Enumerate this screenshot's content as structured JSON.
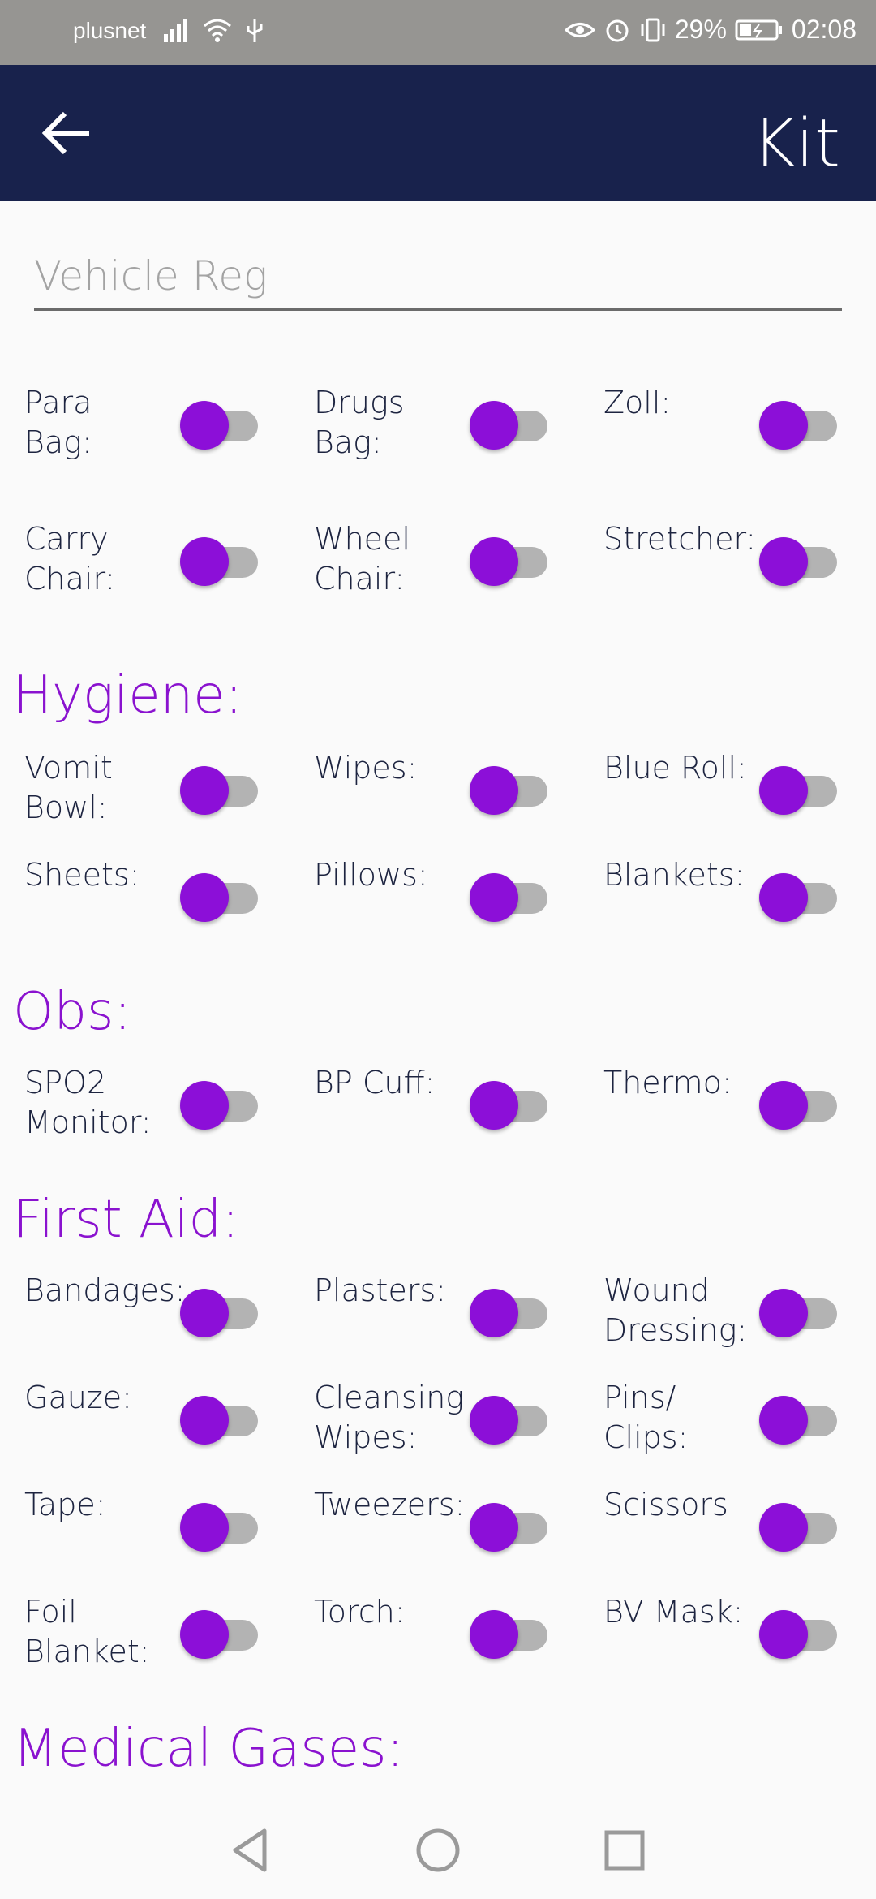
{
  "status_bar": {
    "carrier": "plusnet",
    "battery": "29%",
    "time": "02:08",
    "icons_left": [
      "signal-icon",
      "wifi-icon",
      "usb-icon"
    ],
    "icons_right": [
      "eye-icon",
      "alarm-icon",
      "vibrate-icon",
      "battery-icon"
    ]
  },
  "app_bar": {
    "title": "Kit",
    "back_icon": "arrow-left-icon"
  },
  "vehicle_reg": {
    "placeholder": "Vehicle Reg",
    "value": ""
  },
  "equipment": [
    {
      "label": "Para\nBag:",
      "on": false
    },
    {
      "label": "Drugs\nBag:",
      "on": false
    },
    {
      "label": "Zoll:",
      "on": false
    },
    {
      "label": "Carry\nChair:",
      "on": false
    },
    {
      "label": "Wheel\nChair:",
      "on": false
    },
    {
      "label": "Stretcher:",
      "on": false
    }
  ],
  "hygiene": {
    "title": "Hygiene:",
    "items": [
      {
        "label": "Vomit\nBowl:",
        "on": false
      },
      {
        "label": "Wipes:",
        "on": false
      },
      {
        "label": "Blue Roll:",
        "on": false
      },
      {
        "label": "Sheets:",
        "on": false
      },
      {
        "label": "Pillows:",
        "on": false
      },
      {
        "label": "Blankets:",
        "on": false
      }
    ]
  },
  "obs": {
    "title": "Obs:",
    "items": [
      {
        "label": "SPO2\nMonitor:",
        "on": false
      },
      {
        "label": "BP Cuff:",
        "on": false
      },
      {
        "label": "Thermo:",
        "on": false
      }
    ]
  },
  "first_aid": {
    "title": "First Aid:",
    "items": [
      {
        "label": "Bandages:",
        "on": false
      },
      {
        "label": "Plasters:",
        "on": false
      },
      {
        "label": "Wound\nDressing:",
        "on": false
      },
      {
        "label": "Gauze:",
        "on": false
      },
      {
        "label": "Cleansing\nWipes:",
        "on": false
      },
      {
        "label": "Pins/\nClips:",
        "on": false
      },
      {
        "label": "Tape:",
        "on": false
      },
      {
        "label": "Tweezers:",
        "on": false
      },
      {
        "label": "Scissors",
        "on": false
      },
      {
        "label": "Foil\nBlanket:",
        "on": false
      },
      {
        "label": "Torch:",
        "on": false
      },
      {
        "label": "BV Mask:",
        "on": false
      }
    ]
  },
  "medical_gases": {
    "title": "Medical Gases:"
  },
  "nav_bar": {
    "icons": [
      "back-triangle-icon",
      "home-circle-icon",
      "recents-square-icon"
    ]
  },
  "colors": {
    "app_bar": "#18224c",
    "accent": "#8c0fd8",
    "section": "#8a12cf",
    "status_bar": "#969592"
  }
}
